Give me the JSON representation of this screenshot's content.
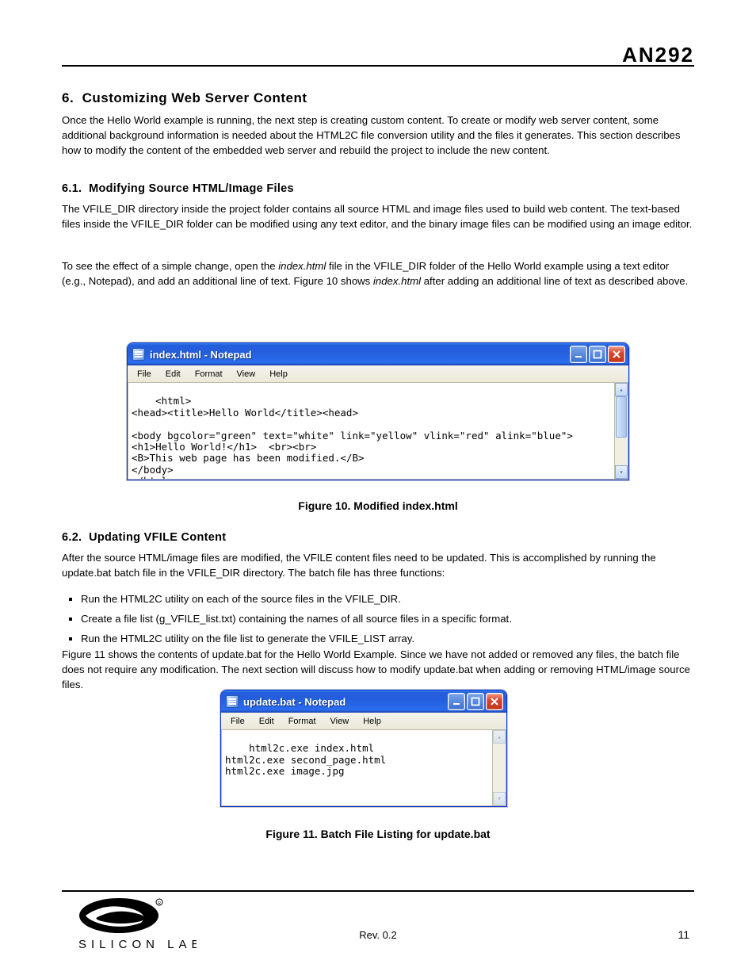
{
  "header": {
    "doc_id": "AN292"
  },
  "section6": {
    "number": "6.",
    "title": "Customizing Web Server Content",
    "intro": "Once the Hello World example is running, the next step is creating custom content. To create or modify web server content, some additional background information is needed about the HTML2C file conversion utility and the files it generates. This section describes how to modify the content of the embedded web server and rebuild the project to include the new content."
  },
  "section6_1": {
    "number": "6.1.",
    "title": "Modifying Source HTML/Image Files",
    "p1": "The VFILE_DIR directory inside the project folder contains all source HTML and image files used to build web content. The text-based files inside the VFILE_DIR folder can be modified using any text editor, and the binary image files can be modified using an image editor.",
    "p2_prefix": "To see the effect of a simple change, open the ",
    "p2_file": "index.html",
    "p2_mid": " file in the VFILE_DIR folder of the Hello World example using a text editor (e.g., Notepad), and add an additional line of text. Figure 10 shows ",
    "p2_file2": "index.html",
    "p2_end": " after adding an additional line of text as described above."
  },
  "notepad1": {
    "title": "index.html - Notepad",
    "menu": {
      "file": "File",
      "edit": "Edit",
      "format": "Format",
      "view": "View",
      "help": "Help"
    },
    "content": "<html>\n<head><title>Hello World</title><head>\n\n<body bgcolor=\"green\" text=\"white\" link=\"yellow\" vlink=\"red\" alink=\"blue\">\n<h1>Hello World!</h1>  <br><br>\n<B>This web page has been modified.</B>\n</body>\n</html>"
  },
  "fig10": "Figure 10. Modified index.html",
  "section6_2": {
    "number": "6.2.",
    "title": "Updating VFILE Content",
    "p1": "After the source HTML/image files are modified, the VFILE content files need to be updated. This is accomplished by running the update.bat batch file in the VFILE_DIR directory. The batch file has three functions:",
    "b1": "Run the HTML2C utility on each of the source files in the VFILE_DIR.",
    "b2": "Create a file list (g_VFILE_list.txt) containing the names of all source files in a specific format.",
    "b3": "Run the HTML2C utility on the file list to generate the VFILE_LIST array.",
    "p2": "Figure 11 shows the contents of update.bat for the Hello World Example. Since we have not added or removed any files, the batch file does not require any modification. The next section will discuss how to modify update.bat when adding or removing HTML/image source files."
  },
  "notepad2": {
    "title": "update.bat - Notepad",
    "menu": {
      "file": "File",
      "edit": "Edit",
      "format": "Format",
      "view": "View",
      "help": "Help"
    },
    "content": "html2c.exe index.html\nhtml2c.exe second_page.html\nhtml2c.exe image.jpg"
  },
  "fig11": "Figure 11. Batch File Listing for update.bat",
  "footer": {
    "rev": "Rev. 0.2",
    "page": "11"
  }
}
